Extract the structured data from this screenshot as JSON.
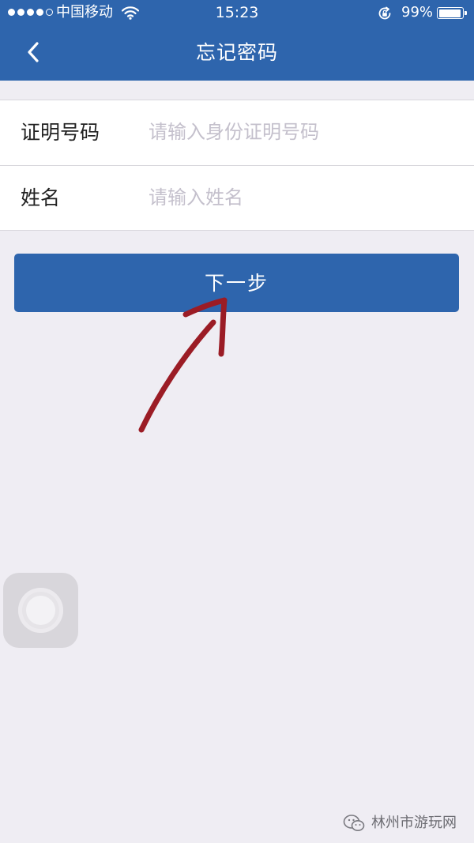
{
  "status_bar": {
    "carrier": "中国移动",
    "time": "15:23",
    "battery_percent": "99%",
    "battery_level": 0.99,
    "signal_bars_filled": 4,
    "signal_bars_total": 5
  },
  "header": {
    "title": "忘记密码",
    "background_color": "#2e65ad"
  },
  "form": {
    "fields": [
      {
        "label": "证明号码",
        "placeholder": "请输入身份证明号码",
        "value": ""
      },
      {
        "label": "姓名",
        "placeholder": "请输入姓名",
        "value": ""
      }
    ]
  },
  "next_button": {
    "label": "下一步",
    "color": "#2e65ad"
  },
  "annotation": {
    "color": "#9b1c25"
  },
  "watermark": {
    "text": "林州市游玩网",
    "icon": "wechat-icon"
  }
}
